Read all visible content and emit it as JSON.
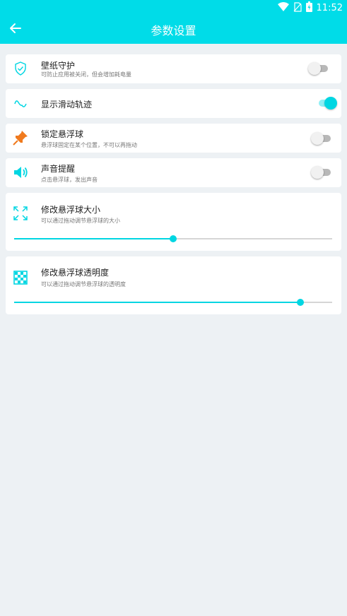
{
  "status": {
    "time": "11:52"
  },
  "header": {
    "title": "参数设置"
  },
  "settings": {
    "wallpaper": {
      "title": "壁纸守护",
      "desc": "可防止应用被关闭，但会增加耗电量",
      "enabled": false
    },
    "trail": {
      "title": "显示滑动轨迹",
      "enabled": true
    },
    "lock": {
      "title": "锁定悬浮球",
      "desc": "悬浮球固定在某个位置，不可以再拖动",
      "enabled": false
    },
    "sound": {
      "title": "声音提醒",
      "desc": "点击悬浮球，发出声音",
      "enabled": false
    },
    "size": {
      "title": "修改悬浮球大小",
      "desc": "可以通过拖动调节悬浮球的大小",
      "value": 0.5
    },
    "opacity": {
      "title": "修改悬浮球透明度",
      "desc": "可以通过拖动调节悬浮球的透明度",
      "value": 0.9
    }
  },
  "colors": {
    "accent": "#00dce8",
    "pin": "#f07a1e",
    "background": "#edf1f4"
  }
}
